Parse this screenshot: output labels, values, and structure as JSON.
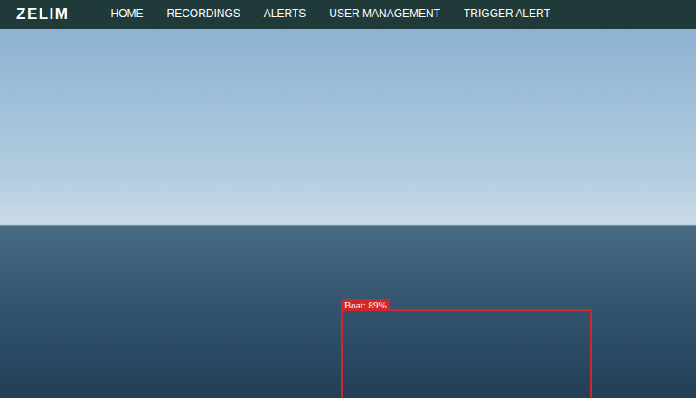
{
  "header": {
    "logo": "ZELIM",
    "nav": [
      {
        "label": "HOME",
        "selected": false
      },
      {
        "label": "RECORDINGS",
        "selected": false
      },
      {
        "label": "ALERTS",
        "selected": false
      },
      {
        "label": "USER MANAGEMENT",
        "selected": false
      },
      {
        "label": "TRIGGER ALERT",
        "selected": false
      }
    ]
  },
  "camera": {
    "detections": [
      {
        "label": "Boat: 89%"
      }
    ]
  }
}
